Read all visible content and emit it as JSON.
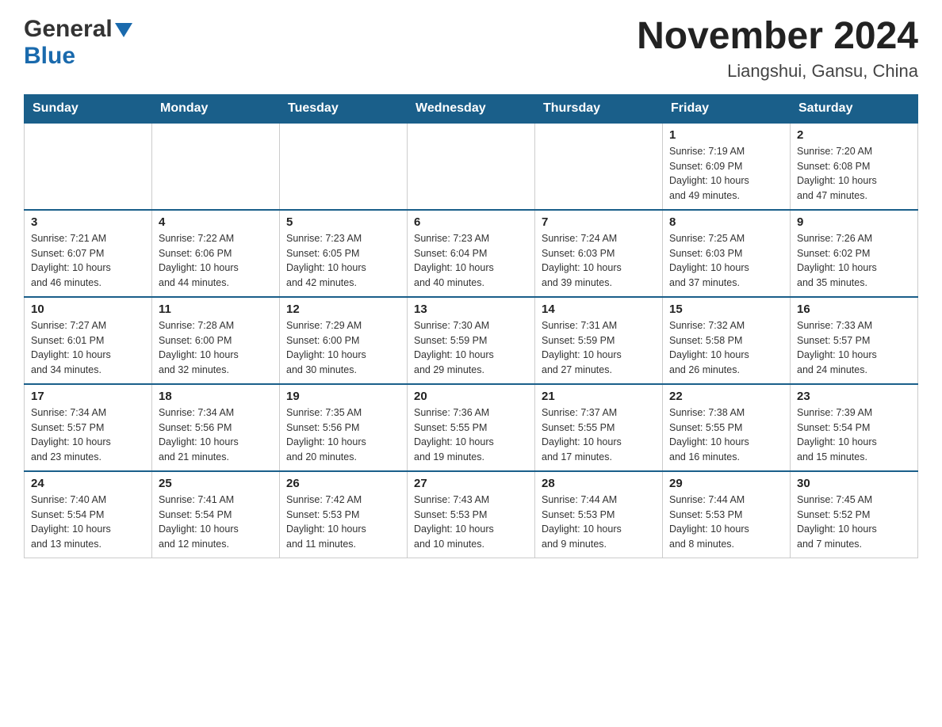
{
  "header": {
    "logo_general": "General",
    "logo_blue": "Blue",
    "month_year": "November 2024",
    "location": "Liangshui, Gansu, China"
  },
  "days_of_week": [
    "Sunday",
    "Monday",
    "Tuesday",
    "Wednesday",
    "Thursday",
    "Friday",
    "Saturday"
  ],
  "weeks": [
    [
      {
        "day": "",
        "info": ""
      },
      {
        "day": "",
        "info": ""
      },
      {
        "day": "",
        "info": ""
      },
      {
        "day": "",
        "info": ""
      },
      {
        "day": "",
        "info": ""
      },
      {
        "day": "1",
        "info": "Sunrise: 7:19 AM\nSunset: 6:09 PM\nDaylight: 10 hours\nand 49 minutes."
      },
      {
        "day": "2",
        "info": "Sunrise: 7:20 AM\nSunset: 6:08 PM\nDaylight: 10 hours\nand 47 minutes."
      }
    ],
    [
      {
        "day": "3",
        "info": "Sunrise: 7:21 AM\nSunset: 6:07 PM\nDaylight: 10 hours\nand 46 minutes."
      },
      {
        "day": "4",
        "info": "Sunrise: 7:22 AM\nSunset: 6:06 PM\nDaylight: 10 hours\nand 44 minutes."
      },
      {
        "day": "5",
        "info": "Sunrise: 7:23 AM\nSunset: 6:05 PM\nDaylight: 10 hours\nand 42 minutes."
      },
      {
        "day": "6",
        "info": "Sunrise: 7:23 AM\nSunset: 6:04 PM\nDaylight: 10 hours\nand 40 minutes."
      },
      {
        "day": "7",
        "info": "Sunrise: 7:24 AM\nSunset: 6:03 PM\nDaylight: 10 hours\nand 39 minutes."
      },
      {
        "day": "8",
        "info": "Sunrise: 7:25 AM\nSunset: 6:03 PM\nDaylight: 10 hours\nand 37 minutes."
      },
      {
        "day": "9",
        "info": "Sunrise: 7:26 AM\nSunset: 6:02 PM\nDaylight: 10 hours\nand 35 minutes."
      }
    ],
    [
      {
        "day": "10",
        "info": "Sunrise: 7:27 AM\nSunset: 6:01 PM\nDaylight: 10 hours\nand 34 minutes."
      },
      {
        "day": "11",
        "info": "Sunrise: 7:28 AM\nSunset: 6:00 PM\nDaylight: 10 hours\nand 32 minutes."
      },
      {
        "day": "12",
        "info": "Sunrise: 7:29 AM\nSunset: 6:00 PM\nDaylight: 10 hours\nand 30 minutes."
      },
      {
        "day": "13",
        "info": "Sunrise: 7:30 AM\nSunset: 5:59 PM\nDaylight: 10 hours\nand 29 minutes."
      },
      {
        "day": "14",
        "info": "Sunrise: 7:31 AM\nSunset: 5:59 PM\nDaylight: 10 hours\nand 27 minutes."
      },
      {
        "day": "15",
        "info": "Sunrise: 7:32 AM\nSunset: 5:58 PM\nDaylight: 10 hours\nand 26 minutes."
      },
      {
        "day": "16",
        "info": "Sunrise: 7:33 AM\nSunset: 5:57 PM\nDaylight: 10 hours\nand 24 minutes."
      }
    ],
    [
      {
        "day": "17",
        "info": "Sunrise: 7:34 AM\nSunset: 5:57 PM\nDaylight: 10 hours\nand 23 minutes."
      },
      {
        "day": "18",
        "info": "Sunrise: 7:34 AM\nSunset: 5:56 PM\nDaylight: 10 hours\nand 21 minutes."
      },
      {
        "day": "19",
        "info": "Sunrise: 7:35 AM\nSunset: 5:56 PM\nDaylight: 10 hours\nand 20 minutes."
      },
      {
        "day": "20",
        "info": "Sunrise: 7:36 AM\nSunset: 5:55 PM\nDaylight: 10 hours\nand 19 minutes."
      },
      {
        "day": "21",
        "info": "Sunrise: 7:37 AM\nSunset: 5:55 PM\nDaylight: 10 hours\nand 17 minutes."
      },
      {
        "day": "22",
        "info": "Sunrise: 7:38 AM\nSunset: 5:55 PM\nDaylight: 10 hours\nand 16 minutes."
      },
      {
        "day": "23",
        "info": "Sunrise: 7:39 AM\nSunset: 5:54 PM\nDaylight: 10 hours\nand 15 minutes."
      }
    ],
    [
      {
        "day": "24",
        "info": "Sunrise: 7:40 AM\nSunset: 5:54 PM\nDaylight: 10 hours\nand 13 minutes."
      },
      {
        "day": "25",
        "info": "Sunrise: 7:41 AM\nSunset: 5:54 PM\nDaylight: 10 hours\nand 12 minutes."
      },
      {
        "day": "26",
        "info": "Sunrise: 7:42 AM\nSunset: 5:53 PM\nDaylight: 10 hours\nand 11 minutes."
      },
      {
        "day": "27",
        "info": "Sunrise: 7:43 AM\nSunset: 5:53 PM\nDaylight: 10 hours\nand 10 minutes."
      },
      {
        "day": "28",
        "info": "Sunrise: 7:44 AM\nSunset: 5:53 PM\nDaylight: 10 hours\nand 9 minutes."
      },
      {
        "day": "29",
        "info": "Sunrise: 7:44 AM\nSunset: 5:53 PM\nDaylight: 10 hours\nand 8 minutes."
      },
      {
        "day": "30",
        "info": "Sunrise: 7:45 AM\nSunset: 5:52 PM\nDaylight: 10 hours\nand 7 minutes."
      }
    ]
  ]
}
